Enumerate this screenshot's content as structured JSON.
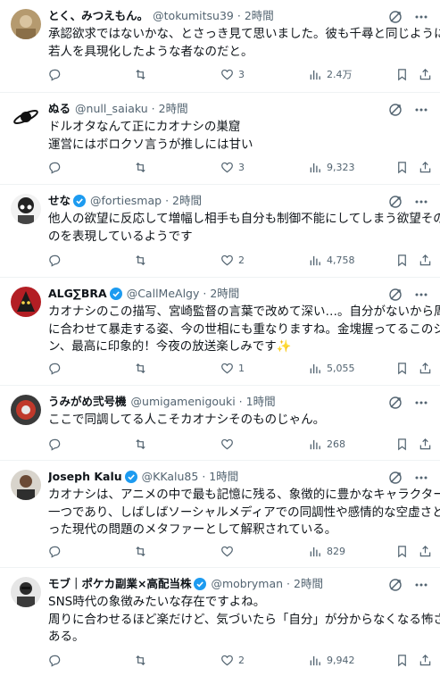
{
  "tweets": [
    {
      "name": "とく、みつえもん。",
      "handle": "@tokumitsu39",
      "time": "2時間",
      "verified": false,
      "lines": [
        "承認欲求ではないかな、とさっき見て思いました。彼も千尋と同じように、",
        "若人を具現化したような者なのだと。"
      ],
      "reply": "",
      "retweet": "",
      "like": "3",
      "views": "2.4万"
    },
    {
      "name": "ぬる",
      "handle": "@null_saiaku",
      "time": "2時間",
      "verified": false,
      "lines": [
        "ドルオタなんて正にカオナシの巣窟",
        "運営にはボロクソ言うが推しには甘い"
      ],
      "reply": "",
      "retweet": "",
      "like": "3",
      "views": "9,323"
    },
    {
      "name": "せな",
      "handle": "@fortiesmap",
      "time": "2時間",
      "verified": true,
      "lines": [
        "他人の欲望に反応して増幅し相手も自分も制御不能にしてしまう欲望そのも",
        "のを表現しているようです"
      ],
      "reply": "",
      "retweet": "",
      "like": "2",
      "views": "4,758"
    },
    {
      "name": "ALG∑BRA",
      "handle": "@CallMeAlgy",
      "time": "2時間",
      "verified": true,
      "lines": [
        "カオナシのこの描写、宮崎監督の言葉で改めて深い…。自分がないから周り",
        "に合わせて暴走する姿、今の世相にも重なりますね。金塊握ってるこのシー",
        "ン、最高に印象的！今夜の放送楽しみです"
      ],
      "reply": "",
      "retweet": "",
      "like": "1",
      "views": "5,055"
    },
    {
      "name": "うみがめ弐号機",
      "handle": "@umigamenigouki",
      "time": "1時間",
      "verified": false,
      "lines": [
        "ここで同調してる人こそカオナシそのものじゃん。"
      ],
      "reply": "",
      "retweet": "",
      "like": "",
      "views": "268"
    },
    {
      "name": "Joseph Kalu",
      "handle": "@KKalu85",
      "time": "1時間",
      "verified": true,
      "lines": [
        "カオナシは、アニメの中で最も記憶に残る、象徴的に豊かなキャラクターの",
        "一つであり、しばしばソーシャルメディアでの同調性や感情的な空虚さとい",
        "った現代の問題のメタファーとして解釈されている。"
      ],
      "reply": "",
      "retweet": "",
      "like": "",
      "views": "829"
    },
    {
      "name": "モブ｜ポケカ副業×高配当株",
      "handle": "@mobryman",
      "time": "2時間",
      "verified": true,
      "lines": [
        "SNS時代の象徴みたいな存在ですよね。",
        "周りに合わせるほど楽だけど、気づいたら「自分」が分からなくなる怖さが",
        "ある。"
      ],
      "reply": "",
      "retweet": "",
      "like": "2",
      "views": "9,942"
    }
  ],
  "sparkle": "✨",
  "colors": {
    "verified": "#1d9bf0",
    "muted": "#536471",
    "text": "#0f1419",
    "divider": "#eff3f4"
  }
}
